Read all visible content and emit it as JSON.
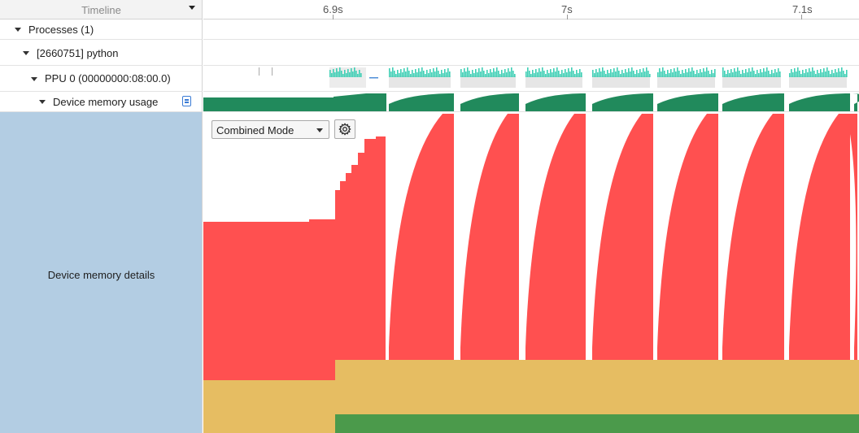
{
  "header": {
    "title": "Timeline"
  },
  "ruler": {
    "ticks": [
      "6.9s",
      "7s",
      "7.1s"
    ]
  },
  "tree": {
    "processes": "Processes (1)",
    "process": "[2660751] python",
    "device": "PPU 0 (00000000:08:00.0)",
    "memory_usage": "Device memory usage"
  },
  "details": {
    "label": "Device memory details",
    "mode_select": "Combined Mode"
  },
  "colors": {
    "memory_red": "#ff5050",
    "memory_yellow": "#e6bd62",
    "memory_green": "#4b9a4b",
    "usage_green": "#218a5c",
    "kernel_teal": "#3fcfb5",
    "panel_blue": "#b3cde3"
  }
}
